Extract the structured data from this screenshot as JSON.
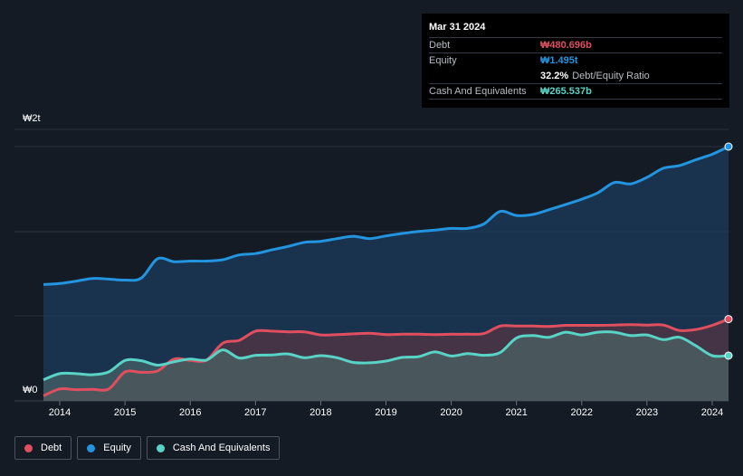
{
  "tooltip": {
    "date": "Mar 31 2024",
    "debt_label": "Debt",
    "debt_value": "₩480.696b",
    "equity_label": "Equity",
    "equity_value": "₩1.495t",
    "ratio_value": "32.2%",
    "ratio_label": "Debt/Equity Ratio",
    "cash_label": "Cash And Equivalents",
    "cash_value": "₩265.537b"
  },
  "legend": {
    "debt": "Debt",
    "equity": "Equity",
    "cash": "Cash And Equivalents"
  },
  "colors": {
    "debt": "#e04f5f",
    "equity": "#2394df",
    "cash": "#58d3c5",
    "background": "#151b24"
  },
  "chart_data": {
    "type": "area",
    "y_tick_labels": [
      "₩2t",
      "₩0"
    ],
    "x_tick_labels": [
      "2014",
      "2015",
      "2016",
      "2017",
      "2018",
      "2019",
      "2020",
      "2021",
      "2022",
      "2023",
      "2024"
    ],
    "ylim": [
      0,
      1600
    ],
    "y_unit": "₩ billions",
    "grid": true,
    "legend_position": "bottom-left",
    "series": [
      {
        "name": "Equity",
        "x": [
          2013.75,
          2014.0,
          2014.25,
          2014.5,
          2014.75,
          2015.0,
          2015.25,
          2015.5,
          2015.75,
          2016.0,
          2016.25,
          2016.5,
          2016.75,
          2017.0,
          2017.25,
          2017.5,
          2017.75,
          2018.0,
          2018.25,
          2018.5,
          2018.75,
          2019.0,
          2019.25,
          2019.5,
          2019.75,
          2020.0,
          2020.25,
          2020.5,
          2020.75,
          2021.0,
          2021.25,
          2021.5,
          2021.75,
          2022.0,
          2022.25,
          2022.5,
          2022.75,
          2023.0,
          2023.25,
          2023.5,
          2023.75,
          2024.0,
          2024.25
        ],
        "values": [
          684,
          690,
          704,
          720,
          716,
          710,
          722,
          836,
          818,
          822,
          822,
          830,
          858,
          866,
          888,
          908,
          932,
          938,
          954,
          968,
          954,
          970,
          984,
          996,
          1004,
          1014,
          1014,
          1040,
          1114,
          1090,
          1096,
          1124,
          1154,
          1186,
          1224,
          1284,
          1276,
          1314,
          1368,
          1384,
          1418,
          1450,
          1495
        ]
      },
      {
        "name": "Debt",
        "x": [
          2013.75,
          2014.0,
          2014.25,
          2014.5,
          2014.75,
          2015.0,
          2015.25,
          2015.5,
          2015.75,
          2016.0,
          2016.25,
          2016.5,
          2016.75,
          2017.0,
          2017.25,
          2017.5,
          2017.75,
          2018.0,
          2018.25,
          2018.5,
          2018.75,
          2019.0,
          2019.25,
          2019.5,
          2019.75,
          2020.0,
          2020.25,
          2020.5,
          2020.75,
          2021.0,
          2021.25,
          2021.5,
          2021.75,
          2022.0,
          2022.25,
          2022.5,
          2022.75,
          2023.0,
          2023.25,
          2023.5,
          2023.75,
          2024.0,
          2024.25
        ],
        "values": [
          30,
          70,
          66,
          68,
          70,
          170,
          168,
          176,
          246,
          238,
          240,
          340,
          356,
          410,
          410,
          406,
          406,
          388,
          390,
          394,
          398,
          390,
          392,
          392,
          390,
          392,
          392,
          396,
          440,
          440,
          440,
          438,
          444,
          444,
          444,
          446,
          448,
          446,
          446,
          414,
          420,
          444,
          481
        ]
      },
      {
        "name": "Cash And Equivalents",
        "x": [
          2013.75,
          2014.0,
          2014.25,
          2014.5,
          2014.75,
          2015.0,
          2015.25,
          2015.5,
          2015.75,
          2016.0,
          2016.25,
          2016.5,
          2016.75,
          2017.0,
          2017.25,
          2017.5,
          2017.75,
          2018.0,
          2018.25,
          2018.5,
          2018.75,
          2019.0,
          2019.25,
          2019.5,
          2019.75,
          2020.0,
          2020.25,
          2020.5,
          2020.75,
          2021.0,
          2021.25,
          2021.5,
          2021.75,
          2022.0,
          2022.25,
          2022.5,
          2022.75,
          2023.0,
          2023.25,
          2023.5,
          2023.75,
          2024.0,
          2024.25
        ],
        "values": [
          124,
          160,
          160,
          154,
          170,
          238,
          236,
          210,
          230,
          246,
          240,
          300,
          252,
          268,
          270,
          276,
          254,
          266,
          254,
          226,
          224,
          234,
          256,
          260,
          288,
          264,
          278,
          268,
          284,
          370,
          384,
          374,
          404,
          388,
          404,
          404,
          384,
          388,
          360,
          374,
          324,
          266,
          266
        ]
      }
    ]
  }
}
